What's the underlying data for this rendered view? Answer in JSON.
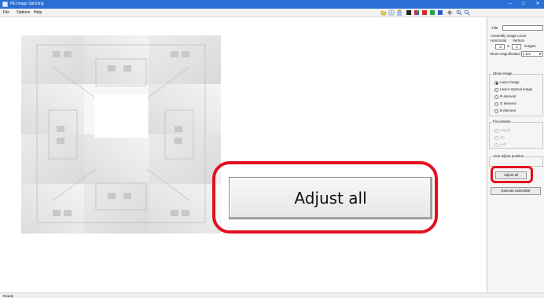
{
  "window": {
    "title": "PE Image Stitching",
    "minimize": "–",
    "maximize": "□",
    "close": "✕"
  },
  "menu": {
    "file": "File",
    "options": "Options",
    "help": "Help"
  },
  "toolbar": {
    "icons": [
      "open-icon",
      "grid-icon",
      "layers-icon",
      "color-black-icon",
      "color-mixed-icon",
      "color-red-icon",
      "color-green-icon",
      "color-blue-icon",
      "cross-icon",
      "zoom-in-icon",
      "zoom-out-icon"
    ]
  },
  "panel": {
    "title_label": "Title",
    "title_value": "",
    "assembly_count_label": "Assembly image count",
    "horizontal_label": "Horizontal",
    "vertical_label": "Vertical",
    "horizontal_value": "3",
    "times": "X",
    "vertical_value": "4",
    "images_label": "images",
    "magnification_label": "Show magnification",
    "magnification_value": "x 1/4",
    "show_image": {
      "title": "Show image",
      "options": [
        "Laser image",
        "Laser+Optical image",
        "R element",
        "G element",
        "B element"
      ],
      "selected": "Laser image"
    },
    "fix_position": {
      "title": "Fix position",
      "options": [
        "Layout",
        "Up",
        "Left"
      ]
    },
    "auto_adjust_title": "Auto adjust position",
    "adjust_all": "Adjust all",
    "execute": "Execute assemble"
  },
  "callout": {
    "label": "Adjust all"
  },
  "status": {
    "text": "Ready"
  },
  "colors": {
    "titlebar": "#2b6fd6",
    "highlight": "#e3101f",
    "panel": "#f5f5f5"
  }
}
